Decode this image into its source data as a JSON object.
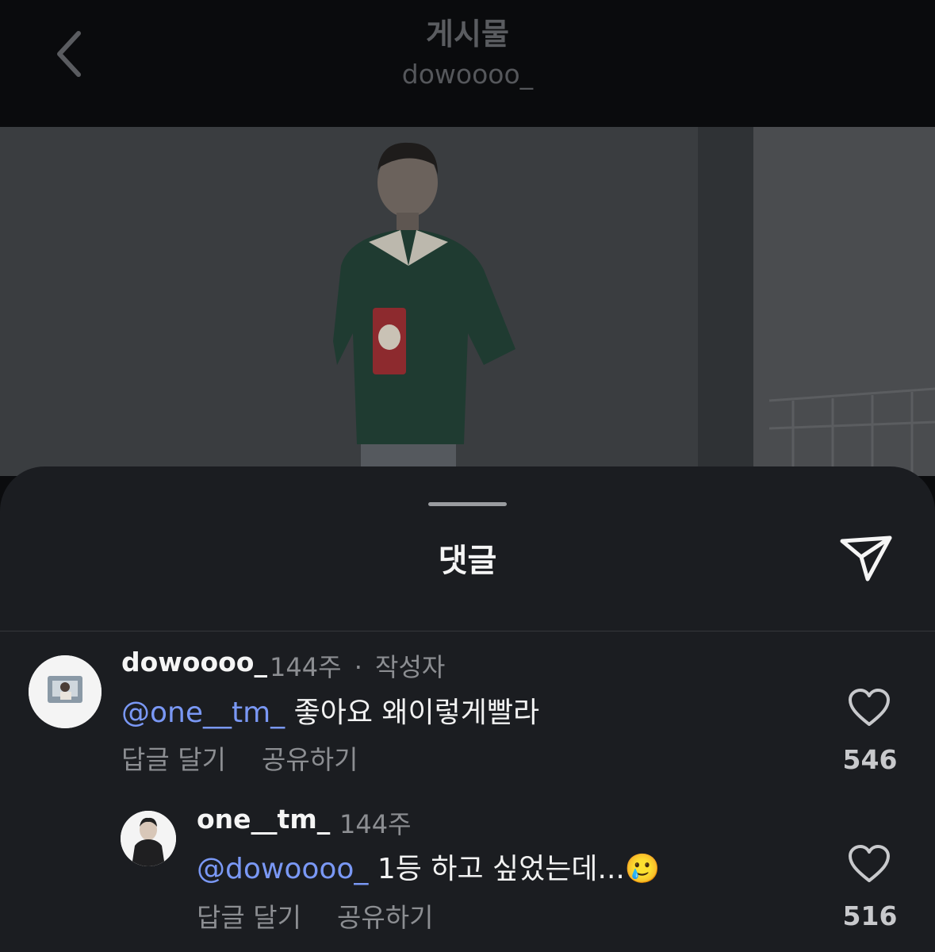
{
  "header": {
    "title": "게시물",
    "subtitle": "dowoooo_"
  },
  "sheet": {
    "title": "댓글"
  },
  "comments": [
    {
      "username": "dowoooo_",
      "age": "144주",
      "separator": "·",
      "author_tag": "작성자",
      "mention": "@one__tm_",
      "text": " 좋아요 왜이렇게빨라",
      "reply_label": "답글 달기",
      "share_label": "공유하기",
      "like_count": "546"
    },
    {
      "username": "one__tm_",
      "age": "144주",
      "mention": "@dowoooo_",
      "text": " 1등 하고 싶었는데...",
      "emoji": "🥲",
      "reply_label": "답글 달기",
      "share_label": "공유하기",
      "like_count": "516"
    }
  ],
  "icons": {
    "back": "chevron-left-icon",
    "share": "paper-plane-icon",
    "like": "heart-outline-icon"
  },
  "colors": {
    "mention": "#7a98f5",
    "sheet_bg": "#1b1d21"
  }
}
